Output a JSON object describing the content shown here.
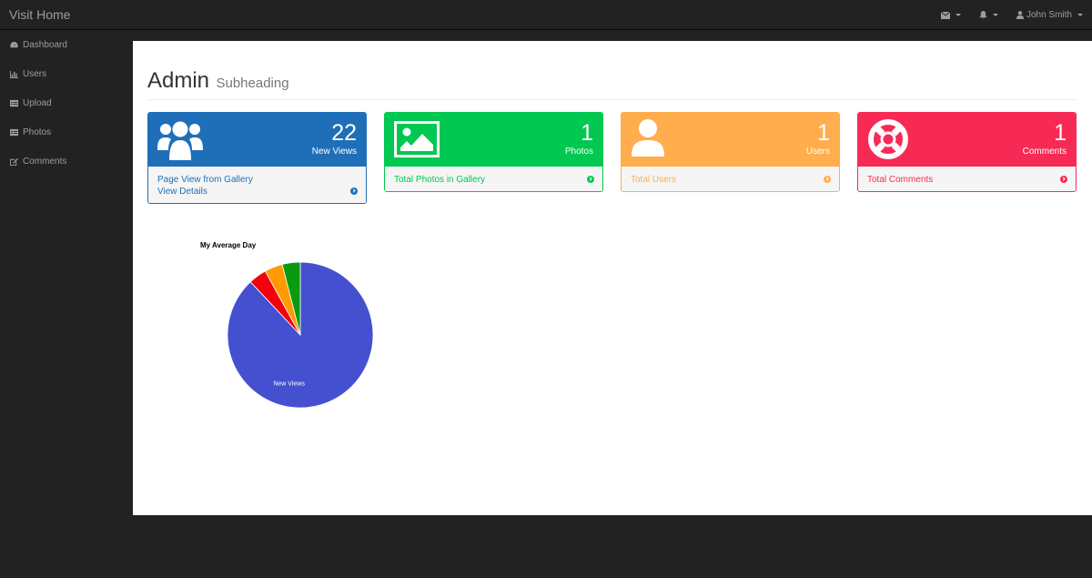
{
  "navbar": {
    "brand": "Visit Home",
    "user_name": "John Smith"
  },
  "sidebar": {
    "items": [
      {
        "label": "Dashboard",
        "icon": "dashboard-icon"
      },
      {
        "label": "Users",
        "icon": "bar-chart-icon"
      },
      {
        "label": "Upload",
        "icon": "table-icon"
      },
      {
        "label": "Photos",
        "icon": "table-icon"
      },
      {
        "label": "Comments",
        "icon": "edit-icon"
      }
    ]
  },
  "header": {
    "title": "Admin",
    "subtitle": "Subheading"
  },
  "panels": [
    {
      "number": "22",
      "caption": "New Views",
      "footer_line1": "Page View from Gallery",
      "footer_line2": "View Details",
      "color": "#1f6fb8",
      "icon": "users-icon"
    },
    {
      "number": "1",
      "caption": "Photos",
      "footer_line1": "Total Photos in Gallery",
      "color": "#00c851",
      "icon": "picture-icon"
    },
    {
      "number": "1",
      "caption": "Users",
      "footer_line1": "Total Users",
      "color": "#ffad4d",
      "icon": "user-icon"
    },
    {
      "number": "1",
      "caption": "Comments",
      "footer_line1": "Total Comments",
      "color": "#f72a55",
      "icon": "life-ring-icon"
    }
  ],
  "chart_data": {
    "type": "pie",
    "title": "My Average Day",
    "slices": [
      {
        "label": "New Views",
        "value": 22,
        "color": "#4450d0"
      },
      {
        "label": "",
        "value": 1,
        "color": "#f2000d"
      },
      {
        "label": "",
        "value": 1,
        "color": "#ff9a00"
      },
      {
        "label": "",
        "value": 1,
        "color": "#0a9a10"
      }
    ]
  }
}
